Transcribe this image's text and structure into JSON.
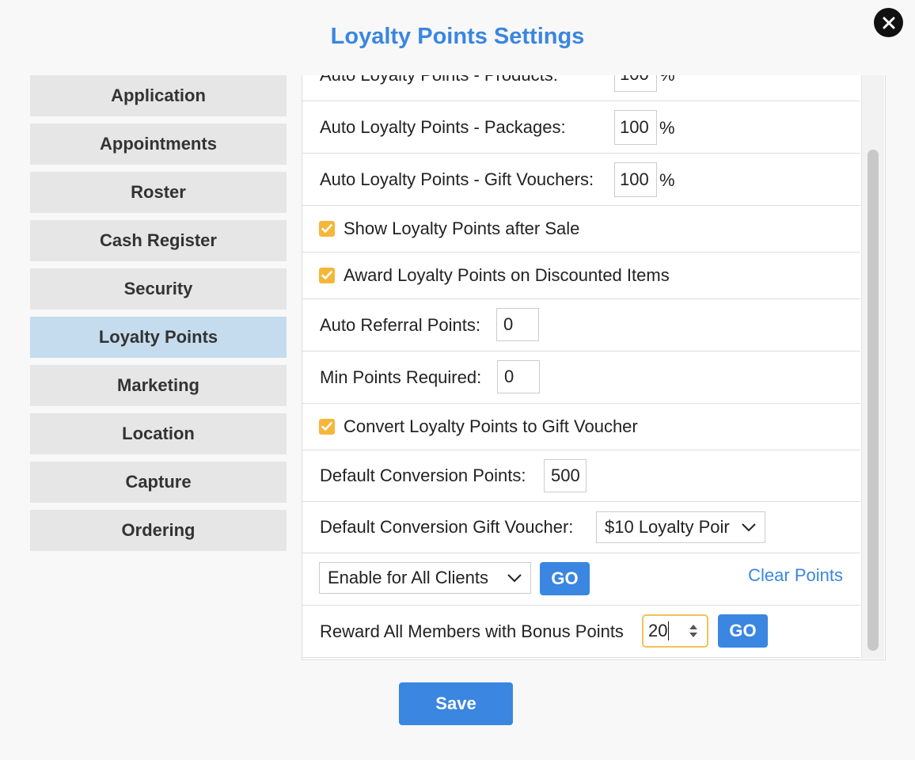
{
  "title": "Loyalty Points Settings",
  "sidebar": {
    "items": [
      {
        "label": "Application"
      },
      {
        "label": "Appointments"
      },
      {
        "label": "Roster"
      },
      {
        "label": "Cash Register"
      },
      {
        "label": "Security"
      },
      {
        "label": "Loyalty Points",
        "active": true
      },
      {
        "label": "Marketing"
      },
      {
        "label": "Location"
      },
      {
        "label": "Capture"
      },
      {
        "label": "Ordering"
      }
    ]
  },
  "settings": {
    "products": {
      "label": "Auto Loyalty Points - Products:",
      "value": "100",
      "unit": "%"
    },
    "packages": {
      "label": "Auto Loyalty Points - Packages:",
      "value": "100",
      "unit": "%"
    },
    "gift_vouchers": {
      "label": "Auto Loyalty Points - Gift Vouchers:",
      "value": "100",
      "unit": "%"
    },
    "show_after_sale": {
      "label": "Show Loyalty Points after Sale",
      "checked": true
    },
    "award_discounted": {
      "label": "Award Loyalty Points on Discounted Items",
      "checked": true
    },
    "referral": {
      "label": "Auto Referral Points:",
      "value": "0"
    },
    "min_points": {
      "label": "Min Points Required:",
      "value": "0"
    },
    "convert_voucher": {
      "label": "Convert Loyalty Points to Gift Voucher",
      "checked": true
    },
    "conversion_points": {
      "label": "Default Conversion Points:",
      "value": "500"
    },
    "conversion_voucher": {
      "label": "Default Conversion Gift Voucher:",
      "selected": "$10 Loyalty Poir"
    },
    "enable_clients": {
      "selected": "Enable for All Clients",
      "go_label": "GO",
      "clear_label": "Clear Points"
    },
    "bonus": {
      "label": "Reward All Members with Bonus Points",
      "value": "20",
      "go_label": "GO"
    }
  },
  "save_label": "Save",
  "colors": {
    "accent": "#3a86e0",
    "checkbox": "#f4b73a",
    "active_tab": "#c4dcee",
    "tab": "#e6e6e6"
  }
}
